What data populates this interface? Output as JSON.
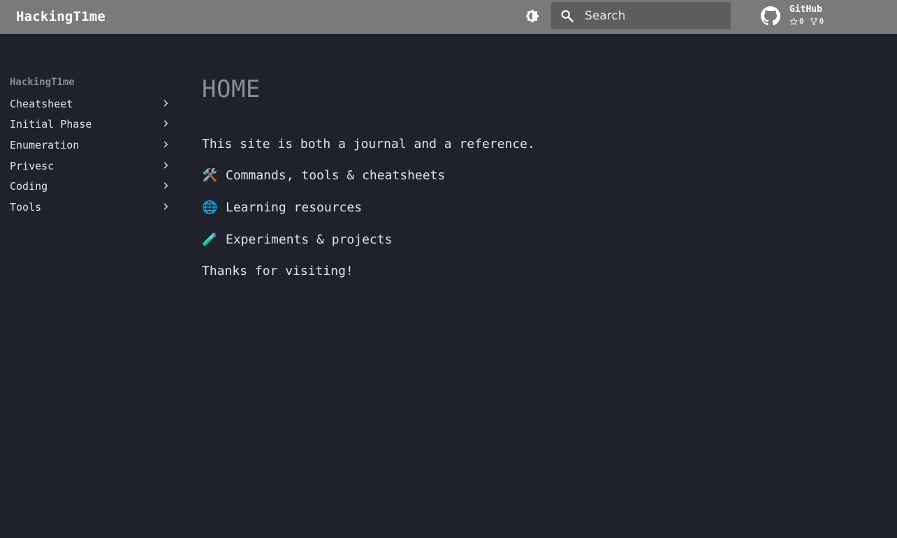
{
  "header": {
    "site_title": "HackingT1me",
    "theme_toggle_icon": "brightness-icon",
    "search": {
      "placeholder": "Search",
      "value": "",
      "icon": "search-icon"
    },
    "repo": {
      "name": "GitHub",
      "icon": "github-icon",
      "stars": "0",
      "forks": "0"
    }
  },
  "sidebar": {
    "title": "HackingT1me",
    "items": [
      {
        "label": "Cheatsheet"
      },
      {
        "label": "Initial Phase"
      },
      {
        "label": "Enumeration"
      },
      {
        "label": "Privesc"
      },
      {
        "label": "Coding"
      },
      {
        "label": "Tools"
      }
    ]
  },
  "main": {
    "title": "HOME",
    "intro": "This site is both a journal and a reference.",
    "bullets": [
      {
        "emoji": "🛠️",
        "text": "Commands, tools & cheatsheets"
      },
      {
        "emoji": "🌐",
        "text": "Learning resources"
      },
      {
        "emoji": "🧪",
        "text": "Experiments & projects"
      }
    ],
    "outro": "Thanks for visiting!"
  },
  "colors": {
    "header_bg": "#7a7a7a",
    "page_bg": "#1f212b",
    "search_bg": "#5e5e5e",
    "text": "#e2e3e8",
    "muted": "#8a8c97"
  }
}
